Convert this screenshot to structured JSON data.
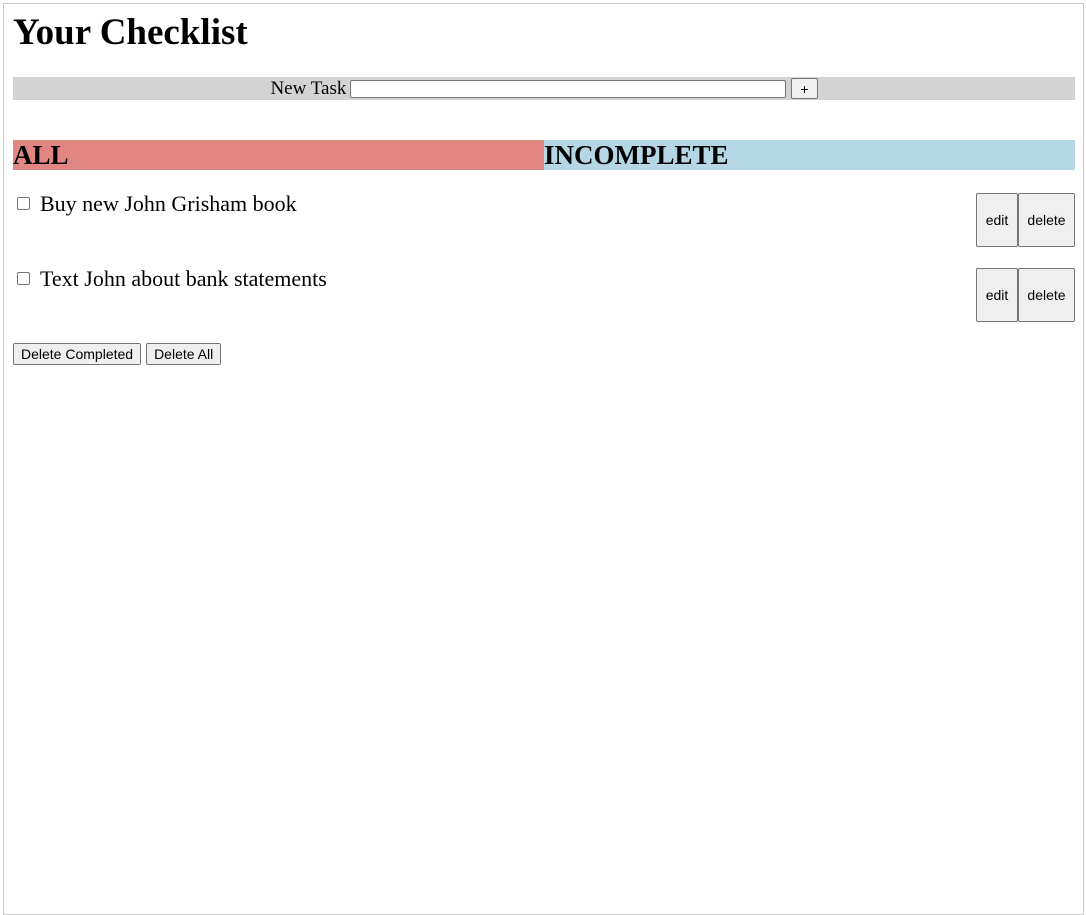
{
  "page": {
    "title": "Your Checklist"
  },
  "new_task": {
    "label": "New Task",
    "value": "",
    "placeholder": "",
    "add_label": "+"
  },
  "filters": {
    "all_label": "ALL",
    "incomplete_label": "INCOMPLETE",
    "colors": {
      "all": "#e28683",
      "incomplete": "#b4d7e3"
    }
  },
  "tasks": [
    {
      "text": "Buy new John Grisham book",
      "checked": false,
      "edit_label": "edit",
      "delete_label": "delete"
    },
    {
      "text": "Text John about bank statements",
      "checked": false,
      "edit_label": "edit",
      "delete_label": "delete"
    }
  ],
  "footer": {
    "delete_completed_label": "Delete Completed",
    "delete_all_label": "Delete All"
  },
  "colors": {
    "new_task_bar": "#d3d3d3"
  }
}
